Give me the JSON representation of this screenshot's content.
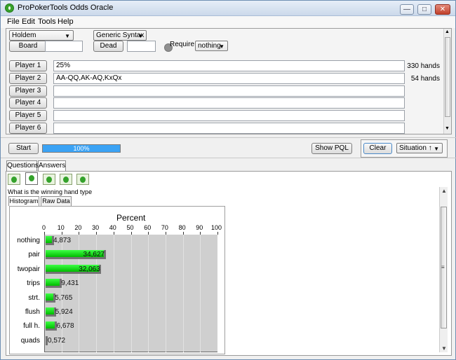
{
  "window": {
    "title": "ProPokerTools Odds Oracle",
    "minimize": "—",
    "maximize": "□",
    "close": "✕"
  },
  "menu": {
    "items": [
      "File",
      "Edit",
      "Tools",
      "Help"
    ]
  },
  "top": {
    "game": "Holdem",
    "syntax": "Generic Syntax",
    "board_button": "Board",
    "board_value": "",
    "dead_button": "Dead",
    "dead_value": "",
    "require_label": "Require",
    "require_value": "nothing"
  },
  "players": [
    {
      "label": "Player 1",
      "range": "25%",
      "hands": "330 hands"
    },
    {
      "label": "Player 2",
      "range": "AA-QQ,AK-AQ,KxQx",
      "hands": "54 hands"
    },
    {
      "label": "Player 3",
      "range": "",
      "hands": ""
    },
    {
      "label": "Player 4",
      "range": "",
      "hands": ""
    },
    {
      "label": "Player 5",
      "range": "",
      "hands": ""
    },
    {
      "label": "Player 6",
      "range": "",
      "hands": ""
    }
  ],
  "controls": {
    "start": "Start",
    "progress": "100%",
    "progress_fraction": 1.0,
    "show_pql": "Show PQL",
    "clear": "Clear",
    "situation": "Situation ↑"
  },
  "tabs": {
    "questions": "Questions",
    "answers": "Answers"
  },
  "question_text": "What is the winning hand type",
  "chart_tabs": {
    "histogram": "Histogram",
    "raw_data": "Raw Data"
  },
  "icons": {
    "app": "poker-drop-icon",
    "drop": "drop-icon",
    "dropdown": "chevron-down-icon",
    "scroll_up": "up-arrow-icon",
    "scroll_down": "down-arrow-icon",
    "grip": "grip-icon"
  },
  "colors": {
    "progress": "#3ba3f5",
    "bars": "#00d400",
    "plot_bg": "#cfcfcf"
  },
  "chart_data": {
    "type": "bar",
    "title": "Percent",
    "xlim": [
      0,
      100
    ],
    "xticks": [
      "0",
      "10",
      "20",
      "30",
      "40",
      "50",
      "60",
      "70",
      "80",
      "90",
      "100"
    ],
    "categories": [
      "nothing",
      "pair",
      "twopair",
      "trips",
      "strt.",
      "flush",
      "full h.",
      "quads"
    ],
    "values": [
      4.873,
      34.627,
      32.063,
      9.431,
      5.765,
      5.924,
      6.678,
      0.572
    ],
    "labels": [
      "4,873",
      "34,627",
      "32,063",
      "9,431",
      "5,765",
      "5,924",
      "6,678",
      "0,572"
    ]
  }
}
